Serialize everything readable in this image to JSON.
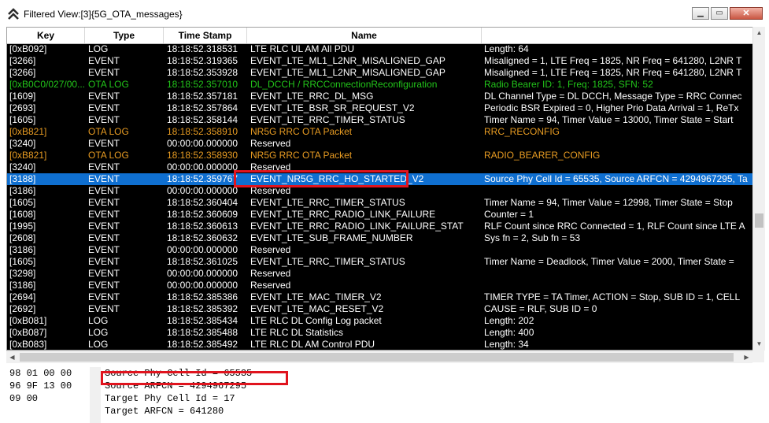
{
  "window": {
    "title": "Filtered View:[3]{5G_OTA_messages}",
    "icon": "double-chevron-up-icon",
    "buttons": [
      "minimize",
      "maximize",
      "close"
    ]
  },
  "columns": [
    "Key",
    "Type",
    "Time Stamp",
    "Name",
    ""
  ],
  "rows": [
    {
      "key": "[0xB092]",
      "type": "LOG",
      "time": "18:18:52.318531",
      "name": "LTE  RLC  UL  AM  All  PDU",
      "info": "Length:  64",
      "style": "white"
    },
    {
      "key": "[3266]",
      "type": "EVENT",
      "time": "18:18:52.319365",
      "name": "EVENT_LTE_ML1_L2NR_MISALIGNED_GAP",
      "info": "Misaligned = 1, LTE Freq = 1825, NR Freq = 641280, L2NR T",
      "style": "white"
    },
    {
      "key": "[3266]",
      "type": "EVENT",
      "time": "18:18:52.353928",
      "name": "EVENT_LTE_ML1_L2NR_MISALIGNED_GAP",
      "info": "Misaligned = 1, LTE Freq = 1825, NR Freq = 641280, L2NR T",
      "style": "white"
    },
    {
      "key": "[0xB0C0/027/00...",
      "type": "OTA  LOG",
      "time": "18:18:52.357010",
      "name": "DL_DCCH  /  RRCConnectionReconfiguration",
      "info": "Radio Bearer ID: 1, Freq: 1825, SFN: 52",
      "style": "green"
    },
    {
      "key": "[1609]",
      "type": "EVENT",
      "time": "18:18:52.357181",
      "name": "EVENT_LTE_RRC_DL_MSG",
      "info": "DL Channel Type = DL DCCH, Message Type = RRC Connec",
      "style": "white"
    },
    {
      "key": "[2693]",
      "type": "EVENT",
      "time": "18:18:52.357864",
      "name": "EVENT_LTE_BSR_SR_REQUEST_V2",
      "info": "Periodic BSR Expired = 0, Higher Prio Data Arrival = 1, ReTx",
      "style": "white"
    },
    {
      "key": "[1605]",
      "type": "EVENT",
      "time": "18:18:52.358144",
      "name": "EVENT_LTE_RRC_TIMER_STATUS",
      "info": "Timer Name = 94, Timer Value = 13000, Timer State = Start",
      "style": "white"
    },
    {
      "key": "[0xB821]",
      "type": "OTA  LOG",
      "time": "18:18:52.358910",
      "name": "NR5G  RRC  OTA  Packet",
      "info": "RRC_RECONFIG",
      "style": "orange"
    },
    {
      "key": "[3240]",
      "type": "EVENT",
      "time": "00:00:00.000000",
      "name": "Reserved",
      "info": "",
      "style": "white"
    },
    {
      "key": "[0xB821]",
      "type": "OTA  LOG",
      "time": "18:18:52.358930",
      "name": "NR5G  RRC  OTA  Packet",
      "info": "RADIO_BEARER_CONFIG",
      "style": "orange"
    },
    {
      "key": "[3240]",
      "type": "EVENT",
      "time": "00:00:00.000000",
      "name": "Reserved",
      "info": "",
      "style": "white"
    },
    {
      "key": "[3188]",
      "type": "EVENT",
      "time": "18:18:52.359767",
      "name": "EVENT_NR5G_RRC_HO_STARTED_V2",
      "info": "Source Phy Cell Id = 65535, Source ARFCN = 4294967295, Ta",
      "style": "selected"
    },
    {
      "key": "[3186]",
      "type": "EVENT",
      "time": "00:00:00.000000",
      "name": "Reserved",
      "info": "",
      "style": "white"
    },
    {
      "key": "[1605]",
      "type": "EVENT",
      "time": "18:18:52.360404",
      "name": "EVENT_LTE_RRC_TIMER_STATUS",
      "info": "Timer Name = 94, Timer Value = 12998, Timer State = Stop",
      "style": "white"
    },
    {
      "key": "[1608]",
      "type": "EVENT",
      "time": "18:18:52.360609",
      "name": "EVENT_LTE_RRC_RADIO_LINK_FAILURE",
      "info": "Counter = 1",
      "style": "white"
    },
    {
      "key": "[1995]",
      "type": "EVENT",
      "time": "18:18:52.360613",
      "name": "EVENT_LTE_RRC_RADIO_LINK_FAILURE_STAT",
      "info": "RLF Count since RRC Connected = 1, RLF Count since LTE A",
      "style": "white"
    },
    {
      "key": "[2608]",
      "type": "EVENT",
      "time": "18:18:52.360632",
      "name": "EVENT_LTE_SUB_FRAME_NUMBER",
      "info": "Sys fn = 2, Sub fn = 53",
      "style": "white"
    },
    {
      "key": "[3186]",
      "type": "EVENT",
      "time": "00:00:00.000000",
      "name": "Reserved",
      "info": "",
      "style": "white"
    },
    {
      "key": "[1605]",
      "type": "EVENT",
      "time": "18:18:52.361025",
      "name": "EVENT_LTE_RRC_TIMER_STATUS",
      "info": "Timer Name = Deadlock, Timer Value = 2000, Timer State =",
      "style": "white"
    },
    {
      "key": "[3298]",
      "type": "EVENT",
      "time": "00:00:00.000000",
      "name": "Reserved",
      "info": "",
      "style": "white"
    },
    {
      "key": "[3186]",
      "type": "EVENT",
      "time": "00:00:00.000000",
      "name": "Reserved",
      "info": "",
      "style": "white"
    },
    {
      "key": "[2694]",
      "type": "EVENT",
      "time": "18:18:52.385386",
      "name": "EVENT_LTE_MAC_TIMER_V2",
      "info": "TIMER TYPE = TA Timer, ACTION = Stop, SUB ID = 1, CELL",
      "style": "white"
    },
    {
      "key": "[2692]",
      "type": "EVENT",
      "time": "18:18:52.385392",
      "name": "EVENT_LTE_MAC_RESET_V2",
      "info": "CAUSE = RLF, SUB ID = 0",
      "style": "white"
    },
    {
      "key": "[0xB081]",
      "type": "LOG",
      "time": "18:18:52.385434",
      "name": "LTE  RLC  DL  Config  Log  packet",
      "info": "Length:  202",
      "style": "white"
    },
    {
      "key": "[0xB087]",
      "type": "LOG",
      "time": "18:18:52.385488",
      "name": "LTE  RLC  DL  Statistics",
      "info": "Length:  400",
      "style": "white"
    },
    {
      "key": "[0xB083]",
      "type": "LOG",
      "time": "18:18:52.385492",
      "name": "LTE  RLC  DL  AM  Control  PDU",
      "info": "Length:  34",
      "style": "white"
    }
  ],
  "hex_lines": [
    "98 01 00 00",
    "96 9F 13 00",
    "09 00"
  ],
  "detail_lines": [
    "Source Phy Cell Id = 65535",
    "Source ARFCN = 4294967295",
    "Target Phy Cell Id = 17",
    "Target ARFCN = 641280"
  ],
  "colors": {
    "grid_background": "#000000",
    "selection": "#0f6fd0",
    "ota_green": "#22c41a",
    "nr5g_orange": "#e79b22",
    "highlight_red": "#e0141e"
  }
}
